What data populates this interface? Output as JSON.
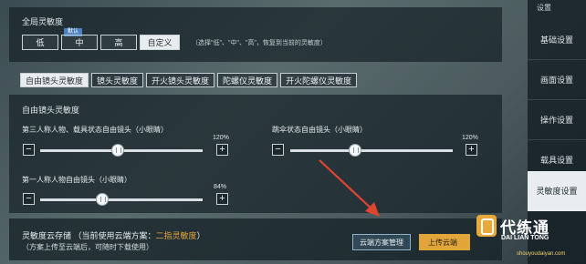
{
  "global": {
    "title": "全局灵敏度",
    "levels": [
      {
        "label": "低",
        "active": false
      },
      {
        "label": "中",
        "active": false
      },
      {
        "label": "高",
        "active": false
      },
      {
        "label": "自定义",
        "active": true
      }
    ],
    "default_tag": "默认",
    "hint": "（选择\"低\"、\"中\"、\"高\"，恢复到当前的灵敏度）"
  },
  "tabs": [
    {
      "label": "自由镜头灵敏度",
      "active": true
    },
    {
      "label": "镜头灵敏度",
      "active": false
    },
    {
      "label": "开火镜头灵敏度",
      "active": false
    },
    {
      "label": "陀螺仪灵敏度",
      "active": false
    },
    {
      "label": "开火陀螺仪灵敏度",
      "active": false
    }
  ],
  "section": {
    "title": "自由镜头灵敏度"
  },
  "sliders": {
    "third_person": {
      "label": "第三人称人物、载具状态自由镜头（小眼睛）",
      "value": "120%",
      "level": 0.48
    },
    "parachute": {
      "label": "跳伞状态自由镜头（小眼睛）",
      "value": "120%",
      "level": 0.4
    },
    "first_person": {
      "label": "第一人称人物自由镜头（小眼睛）",
      "value": "84%",
      "level": 0.38
    }
  },
  "stepper": {
    "minus": "−",
    "plus": "+"
  },
  "cloud": {
    "title": "灵敏度云存储",
    "current_prefix": "（当前使用云端方案：",
    "plan": "二指灵敏度",
    "current_suffix": "）",
    "note": "（方案上传至云端后，可随时下载使用）",
    "manage_button": "云端方案管理",
    "upload_button": "上传云端"
  },
  "sidebar": {
    "top_label": "设置",
    "items": [
      {
        "label": "基础设置",
        "active": false
      },
      {
        "label": "画面设置",
        "active": false
      },
      {
        "label": "操作设置",
        "active": false
      },
      {
        "label": "载具设置",
        "active": false
      },
      {
        "label": "灵敏度设置",
        "active": true
      }
    ]
  },
  "watermark": {
    "title": "代练通",
    "subtitle": "DAI LIAN TONG",
    "url": "shouyoudaiyan.com"
  },
  "colors": {
    "accent": "#e1a53a",
    "panel": "#16222a",
    "active_tab": "#e9edef"
  }
}
